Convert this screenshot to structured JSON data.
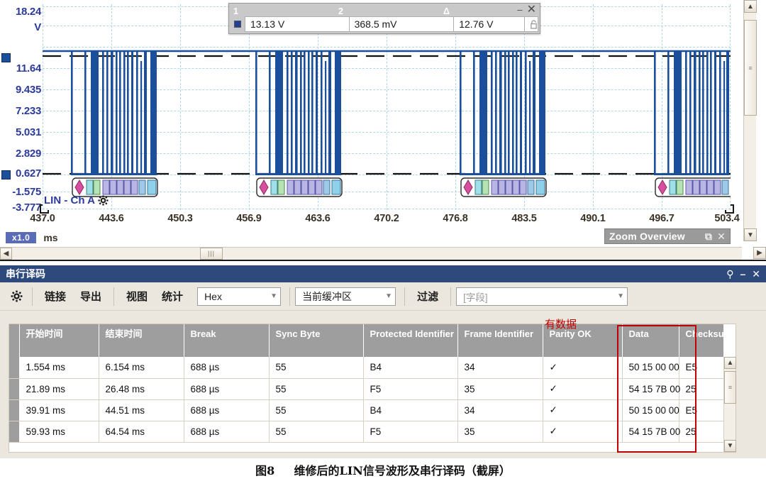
{
  "scope": {
    "y_axis": {
      "labels": [
        "18.24",
        "V",
        "11.64",
        "9.435",
        "7.233",
        "5.031",
        "2.829",
        "0.627",
        "-1.575",
        "-3.777"
      ],
      "unit": "V"
    },
    "x_axis": {
      "labels": [
        "437.0",
        "443.6",
        "450.3",
        "456.9",
        "463.6",
        "470.2",
        "476.8",
        "483.5",
        "490.1",
        "496.7",
        "503.4"
      ],
      "unit": "ms",
      "scale_badge": "x1.0"
    },
    "channel_label": "LIN - Ch A",
    "measurement": {
      "col1_header": "1",
      "col2_header": "2",
      "col3_header": "Δ",
      "col1_value": "13.13 V",
      "col2_value": "368.5 mV",
      "col3_value": "12.76 V",
      "minimize": "–",
      "close": "✕",
      "lock_icon": "lock-icon"
    },
    "zoom_overview": {
      "label": "Zoom Overview",
      "restore": "⧉",
      "close": "✕"
    }
  },
  "chart_data": {
    "type": "line",
    "title": "LIN - Ch A",
    "xlabel": "ms",
    "ylabel": "V",
    "xlim": [
      437.0,
      503.4
    ],
    "ylim": [
      -3.777,
      18.24
    ],
    "x_ticks": [
      437.0,
      443.6,
      450.3,
      456.9,
      463.6,
      470.2,
      476.8,
      483.5,
      490.1,
      496.7,
      503.4
    ],
    "y_ticks": [
      18.24,
      11.64,
      9.435,
      7.233,
      5.031,
      2.829,
      0.627,
      -1.575,
      -3.777
    ],
    "grid": true,
    "idle_high_volts": 13.13,
    "dominant_low_volts": 0.3685,
    "delta_volts": 12.76,
    "bursts": [
      {
        "center_ms": 445.6,
        "start_ms": 443.2,
        "end_ms": 448.4
      },
      {
        "center_ms": 462.1,
        "start_ms": 459.7,
        "end_ms": 465.0
      },
      {
        "center_ms": 480.5,
        "start_ms": 478.1,
        "end_ms": 483.4
      },
      {
        "center_ms": 498.0,
        "start_ms": 495.6,
        "end_ms": 500.9
      }
    ],
    "decode_bubbles": [
      {
        "at_ms": 445.6,
        "fields": [
          "break",
          "sync",
          "pid",
          "d0",
          "d1",
          "d2",
          "d3",
          "checksum"
        ]
      },
      {
        "at_ms": 462.1,
        "fields": [
          "break",
          "sync",
          "pid",
          "d0",
          "d1",
          "d2",
          "d3",
          "checksum"
        ]
      },
      {
        "at_ms": 480.5,
        "fields": [
          "break",
          "sync",
          "pid",
          "d0",
          "d1",
          "d2",
          "d3",
          "checksum"
        ]
      },
      {
        "at_ms": 498.0,
        "fields": [
          "break",
          "sync",
          "pid",
          "d0",
          "d1",
          "d2",
          "d3",
          "checksum"
        ]
      }
    ]
  },
  "panel": {
    "title": "串行译码",
    "title_pin": "一",
    "title_min": "–",
    "title_close": "✕",
    "toolbar": {
      "settings_icon": "gear-icon",
      "link": "链接",
      "export": "导出",
      "view": "视图",
      "stats": "统计",
      "format_value": "Hex",
      "buffer_value": "当前缓冲区",
      "filter": "过滤",
      "field_placeholder": "[字段]"
    },
    "table": {
      "columns": [
        "开始时间",
        "结束时间",
        "Break",
        "Sync Byte",
        "Protected Identifier",
        "Frame Identifier",
        "Parity OK",
        "Data",
        "Checksu"
      ],
      "rows": [
        [
          "1.554 ms",
          "6.154 ms",
          "688 µs",
          "55",
          "B4",
          "34",
          "✓",
          "50 15 00 00",
          "E5"
        ],
        [
          "21.89 ms",
          "26.48 ms",
          "688 µs",
          "55",
          "F5",
          "35",
          "✓",
          "54 15 7B 00",
          "25"
        ],
        [
          "39.91 ms",
          "44.51 ms",
          "688 µs",
          "55",
          "B4",
          "34",
          "✓",
          "50 15 00 00",
          "E5"
        ],
        [
          "59.93 ms",
          "64.54 ms",
          "688 µs",
          "55",
          "F5",
          "35",
          "✓",
          "54 15 7B 00",
          "25"
        ]
      ],
      "highlight_column": "Data",
      "highlight_color": "#c00000",
      "annotation": "有数据"
    }
  },
  "caption": {
    "figure_no": "图8",
    "text": "维修后的LIN信号波形及串行译码（截屏）"
  },
  "colors": {
    "waveform": "#1b4f9c",
    "grid": "#add8e6",
    "panel_title_bg": "#2e4a7d",
    "header_bg": "#9e9e9e",
    "accent_red": "#c00000",
    "axis_text_y": "#2b3a9e",
    "axis_text_x": "#3a3226"
  }
}
